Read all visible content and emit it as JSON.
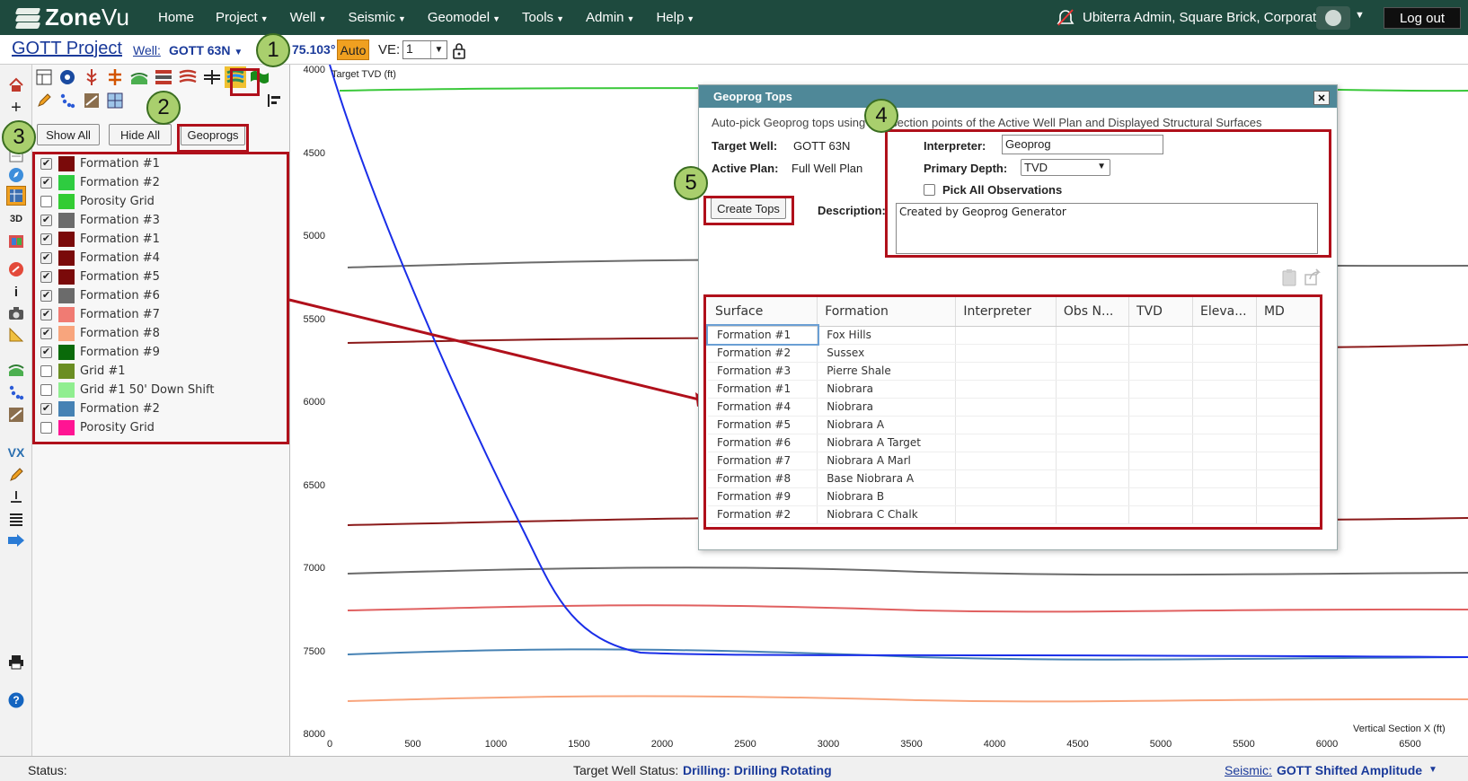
{
  "nav": {
    "brand_zone": "Zone",
    "brand_vu": "Vu",
    "items": [
      "Home",
      "Project",
      "Well",
      "Seismic",
      "Geomodel",
      "Tools",
      "Admin",
      "Help"
    ],
    "user": "Ubiterra Admin, Square Brick, Corporate",
    "logout": "Log out"
  },
  "subbar": {
    "project": "GOTT Project",
    "well_label": "Well:",
    "well_value": "GOTT 63N",
    "azimuth": "75.103°",
    "auto": "Auto",
    "ve_label": "VE:",
    "ve_value": "1"
  },
  "panel": {
    "show_all": "Show All",
    "hide_all": "Hide All",
    "geoprogs": "Geoprogs",
    "layers": [
      {
        "name": "Formation #1",
        "checked": true,
        "color": "#7a0a0a"
      },
      {
        "name": "Formation #2",
        "checked": true,
        "color": "#2ecc40"
      },
      {
        "name": "Porosity Grid",
        "checked": false,
        "color": "#33cc33"
      },
      {
        "name": "Formation #3",
        "checked": true,
        "color": "#6b6b6b"
      },
      {
        "name": "Formation #1",
        "checked": true,
        "color": "#7a0a0a"
      },
      {
        "name": "Formation #4",
        "checked": true,
        "color": "#7a0a0a"
      },
      {
        "name": "Formation #5",
        "checked": true,
        "color": "#7a0a0a"
      },
      {
        "name": "Formation #6",
        "checked": true,
        "color": "#6b6b6b"
      },
      {
        "name": "Formation #7",
        "checked": true,
        "color": "#f07b73"
      },
      {
        "name": "Formation #8",
        "checked": true,
        "color": "#f8a57d"
      },
      {
        "name": "Formation #9",
        "checked": true,
        "color": "#0a6a0a"
      },
      {
        "name": "Grid #1",
        "checked": false,
        "color": "#6b8e23"
      },
      {
        "name": "Grid #1 50' Down Shift",
        "checked": false,
        "color": "#90ee90"
      },
      {
        "name": "Formation #2",
        "checked": true,
        "color": "#4682b4"
      },
      {
        "name": "Porosity Grid",
        "checked": false,
        "color": "#ff1493"
      }
    ]
  },
  "callouts": [
    "1",
    "2",
    "3",
    "4",
    "5"
  ],
  "plot": {
    "y_label": "Target TVD (ft)",
    "x_label": "Vertical Section X (ft)",
    "y_ticks": [
      "4000",
      "4500",
      "5000",
      "5500",
      "6000",
      "6500",
      "7000",
      "7500",
      "8000"
    ],
    "x_ticks": [
      "0",
      "500",
      "1000",
      "1500",
      "2000",
      "2500",
      "3000",
      "3500",
      "4000",
      "4500",
      "5000",
      "5500",
      "6000",
      "6500"
    ]
  },
  "dialog": {
    "title": "Geoprog Tops",
    "description_text": "Auto-pick Geoprog tops using intersection points of the Active Well Plan and Displayed Structural Surfaces",
    "target_well_label": "Target Well:",
    "target_well_value": "GOTT 63N",
    "active_plan_label": "Active Plan:",
    "active_plan_value": "Full Well Plan",
    "interpreter_label": "Interpreter:",
    "interpreter_value": "Geoprog",
    "primary_depth_label": "Primary Depth:",
    "primary_depth_value": "TVD",
    "pick_all_label": "Pick All Observations",
    "create_tops": "Create Tops",
    "description_label": "Description:",
    "description_value": "Created by Geoprog Generator",
    "columns": [
      "Surface",
      "Formation",
      "Interpreter",
      "Obs N...",
      "TVD",
      "Eleva...",
      "MD"
    ],
    "rows": [
      [
        "Formation #1",
        "Fox Hills"
      ],
      [
        "Formation #2",
        "Sussex"
      ],
      [
        "Formation #3",
        "Pierre Shale"
      ],
      [
        "Formation #1",
        "Niobrara"
      ],
      [
        "Formation #4",
        "Niobrara"
      ],
      [
        "Formation #5",
        "Niobrara A"
      ],
      [
        "Formation #6",
        "Niobrara A Target"
      ],
      [
        "Formation #7",
        "Niobrara A Marl"
      ],
      [
        "Formation #8",
        "Base Niobrara A"
      ],
      [
        "Formation #9",
        "Niobrara B"
      ],
      [
        "Formation #2",
        "Niobrara C Chalk"
      ]
    ]
  },
  "status": {
    "label": "Status:",
    "target_label": "Target Well Status:",
    "target_value": "Drilling: Drilling Rotating",
    "seismic_label": "Seismic:",
    "seismic_value": "GOTT Shifted Amplitude"
  }
}
